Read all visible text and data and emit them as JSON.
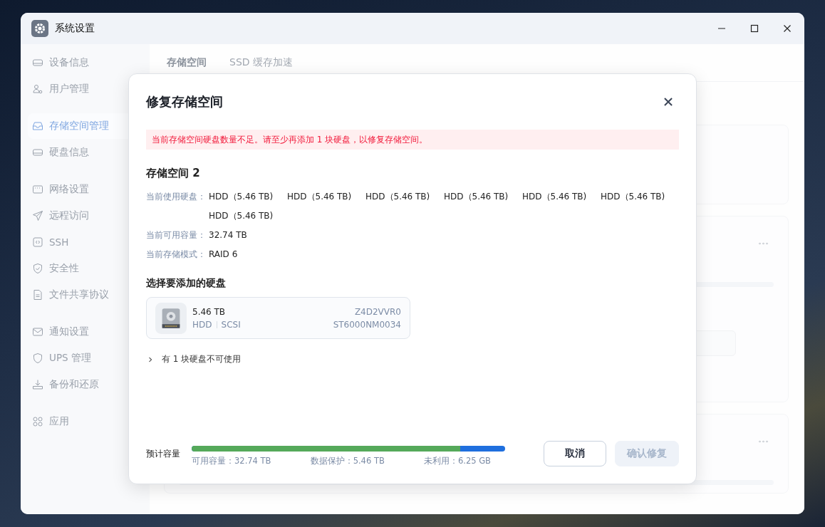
{
  "window": {
    "title": "系统设置"
  },
  "sidebar": {
    "groups": [
      {
        "items": [
          {
            "label": "设备信息",
            "selected": false
          },
          {
            "label": "用户管理",
            "selected": false
          }
        ]
      },
      {
        "items": [
          {
            "label": "存储空间管理",
            "selected": true
          },
          {
            "label": "硬盘信息",
            "selected": false
          }
        ]
      },
      {
        "items": [
          {
            "label": "网络设置",
            "selected": false
          },
          {
            "label": "远程访问",
            "selected": false
          },
          {
            "label": "SSH",
            "selected": false
          },
          {
            "label": "安全性",
            "selected": false
          },
          {
            "label": "文件共享协议",
            "selected": false
          }
        ]
      },
      {
        "items": [
          {
            "label": "通知设置",
            "selected": false
          },
          {
            "label": "UPS 管理",
            "selected": false
          },
          {
            "label": "备份和还原",
            "selected": false
          }
        ]
      },
      {
        "items": [
          {
            "label": "应用",
            "selected": false
          }
        ]
      }
    ]
  },
  "tabs": [
    {
      "label": "存储空间",
      "selected": true
    },
    {
      "label": "SSD 缓存加速",
      "selected": false
    }
  ],
  "dialog": {
    "title": "修复存储空间",
    "alert": "当前存储空间硬盘数量不足。请至少再添加 1 块硬盘，以修复存储空间。",
    "pool_name": "存储空间 2",
    "info": [
      {
        "label": "当前使用硬盘：",
        "values": [
          "HDD（5.46 TB)",
          "HDD（5.46 TB)",
          "HDD（5.46 TB)",
          "HDD（5.46 TB)",
          "HDD（5.46 TB)",
          "HDD（5.46 TB)",
          "HDD（5.46 TB)"
        ]
      },
      {
        "label": "当前可用容量：",
        "values": [
          "32.74 TB"
        ]
      },
      {
        "label": "当前存储模式：",
        "values": [
          "RAID 6"
        ]
      }
    ],
    "select_title": "选择要添加的硬盘",
    "disks": [
      {
        "size": "5.46 TB",
        "type": "HDD",
        "interface": "SCSI",
        "serial": "Z4D2VVR0",
        "model": "ST6000NM0034"
      }
    ],
    "unavailable": {
      "label": "有 1 块硬盘不可使用",
      "expanded": false
    },
    "estimate": {
      "label": "预计容量",
      "level": 0.857,
      "legend": [
        "可用容量：32.74 TB",
        "数据保护：5.46 TB",
        "未利用：6.25 GB"
      ]
    },
    "buttons": [
      {
        "label": "取消",
        "kind": "secondary",
        "disabled": false
      },
      {
        "label": "确认修复",
        "kind": "primary",
        "disabled": true
      }
    ]
  }
}
